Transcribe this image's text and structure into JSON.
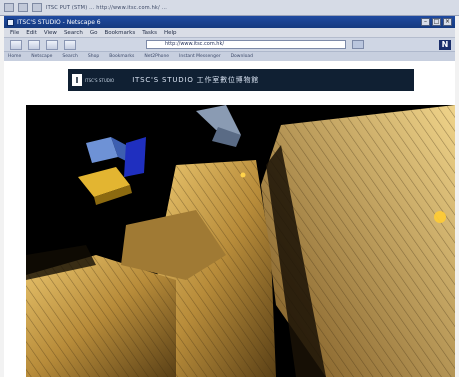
{
  "os_bar": {
    "text": "ITSC PUT (STM) ... http://www.itsc.com.hk/ ..."
  },
  "window": {
    "title": "ITSC'S STUDIO - Netscape 6",
    "controls": [
      "minimize",
      "maximize",
      "close"
    ]
  },
  "menu": {
    "items": [
      "File",
      "Edit",
      "View",
      "Search",
      "Go",
      "Bookmarks",
      "Tasks",
      "Help"
    ]
  },
  "toolbar": {
    "url": "http://www.itsc.com.hk/"
  },
  "bookmarks": {
    "items": [
      "Home",
      "Netscape",
      "Search",
      "Shop",
      "Bookmarks",
      "Net2Phone",
      "Instant Messenger",
      "Download"
    ]
  },
  "site": {
    "logo_text": "ITSC'S STUDIO",
    "title": "ITSC'S STUDIO  工作室數位博物館"
  },
  "colors": {
    "titlebar": "#1f4aa0",
    "site_header": "#102033",
    "scene_gold": "#caa24c"
  }
}
